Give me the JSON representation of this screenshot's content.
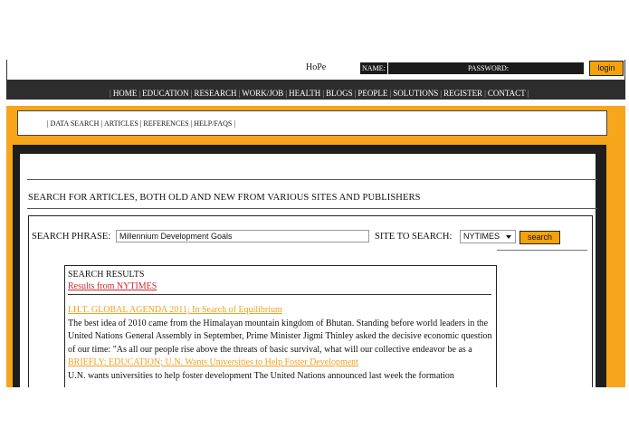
{
  "header": {
    "site_name": "HoPe",
    "name_label": "NAME:",
    "password_label": "PASSWORD:",
    "login_label": "login"
  },
  "main_nav": [
    "HOME",
    "EDUCATION",
    "RESEARCH",
    "WORK/JOB",
    "HEALTH",
    "BLOGS",
    "PEOPLE",
    "SOLUTIONS",
    "REGISTER",
    "CONTACT"
  ],
  "sub_nav": [
    "DATA SEARCH",
    "ARTICLES",
    "REFERENCES",
    "HELP/FAQS"
  ],
  "search": {
    "heading": "SEARCH FOR ARTICLES, BOTH OLD AND NEW FROM VARIOUS SITES AND PUBLISHERS",
    "phrase_label": "SEARCH PHRASE:",
    "phrase_value": "Millennium Development Goals",
    "site_label": "SITE TO SEARCH:",
    "site_selected": "NYTIMES",
    "search_button": "search"
  },
  "results": {
    "title": "SEARCH RESULTS",
    "from": "Results from NYTIMES",
    "items": [
      {
        "title": "I.H.T. GLOBAL AGENDA 2011; In Search of Equilibrium",
        "text": "The best idea of 2010 came from the Himalayan mountain kingdom of Bhutan. Standing before world leaders in the United Nations General Assembly in September, Prime Minister Jigmi Thinley asked the decisive economic question of our time: \"As all our people rise above the threats of basic survival, what will our collective endeavor be as a"
      },
      {
        "title": "BRIEFLY: EDUCATION; U.N. Wants Universities to Help Foster Development",
        "text": "U.N. wants universities to help foster development The United Nations announced last week the formation"
      }
    ]
  },
  "colors": {
    "accent": "#f7a51a",
    "nav_dark": "#2d2d2d",
    "link_red": "#d1262a",
    "link_orange": "#f0a020"
  }
}
